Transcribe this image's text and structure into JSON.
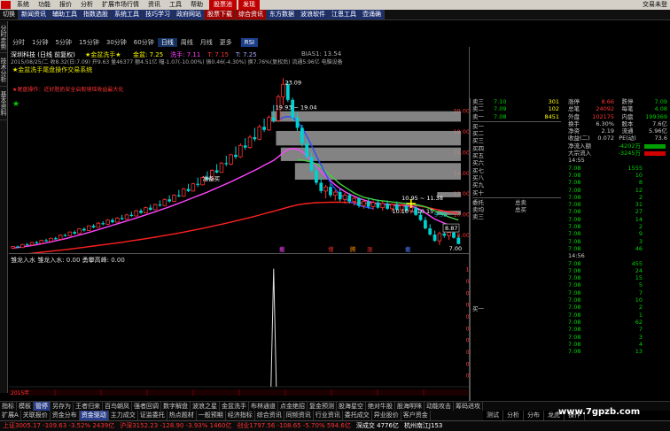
{
  "menu": {
    "items": [
      "系统",
      "功能",
      "报价",
      "分析",
      "扩展市场行情",
      "资讯",
      "工具",
      "帮助"
    ],
    "highlight_items": [
      "股票池",
      "发现"
    ],
    "right_label": "交易未登"
  },
  "toolbar": {
    "items": [
      "切换",
      "新闻资讯",
      "辅助工具",
      "指数选股",
      "系统工具",
      "技巧学习",
      "政府网站",
      "股票下载",
      "综合资讯",
      "东方数据",
      "波浪软件",
      "江恩工具",
      "壶涌确"
    ]
  },
  "left_tabs": [
    "分时走势",
    "技术分析",
    "基本资料"
  ],
  "period_bar": {
    "items": [
      "分时",
      "1分钟",
      "5分钟",
      "15分钟",
      "30分钟",
      "60分钟",
      "日线",
      "周线",
      "月线",
      "更多"
    ],
    "active": "日线",
    "rsi_label": "RSI"
  },
  "main_chart": {
    "header_line1_left": "★金盆洗手★",
    "header_line1_items": [
      "金盆: 7.25",
      "洗手: 7.11",
      "T: 7.15",
      "T: 7.25"
    ],
    "header_line1_bias": "BIAS1: 13.54",
    "header_line2": "2015/08/25/二 收8.32(日:7.09) 开9.63 量46377 额4.51亿 幅-1.07(-10.00%) 振0.46(-4.30%) 换7.76%(复权后) 流通5.96亿 电脑设备",
    "stock_line": "深圳科技 (日线 前复权)",
    "legend1": "★金盆洗手尾盘操作交易系统",
    "legend2": "★尾盘操作：近好胜奶安全启般境瑶收益最大化",
    "peak_label": "23.09",
    "range_label": "19.93 ~ 19.04",
    "buy_label": "准备买",
    "box_label1": "10.95 ~ 11.38",
    "box_label2": "10.10 ~ 10.15",
    "low_label": "7.00",
    "price_tag": "8.87",
    "price_tag2": "9.92",
    "signal_labels": [
      "撤",
      "增",
      "腾",
      "涨",
      "撤"
    ],
    "y_ticks": [
      "20.00",
      "18.00",
      "16.00",
      "14.00",
      "12.00",
      "10.00",
      "8.00"
    ]
  },
  "sub_chart": {
    "header": "雏龙入水 雏龙入水: 0.00 勇攀高峰: 0.00",
    "y_ticks": [
      "1.00",
      "0.90",
      "0.80",
      "0.70",
      "0.60",
      "0.50",
      "0.40",
      "0.30",
      "0.20",
      "0.10"
    ],
    "date_label": "2015年"
  },
  "quote_panel": {
    "sell": [
      {
        "label": "卖三",
        "price": "7.10",
        "vol": "301"
      },
      {
        "label": "卖二",
        "price": "7.09",
        "vol": "102"
      },
      {
        "label": "卖一",
        "price": "7.08",
        "vol": "8451"
      }
    ],
    "buy": [
      "买一",
      "买二",
      "买三",
      "买四",
      "买五",
      "买六",
      "买七",
      "买八",
      "买九",
      "买十"
    ],
    "stats_left": [
      {
        "label": "涨停",
        "value": "8.66"
      },
      {
        "label": "总笔",
        "value": "24092"
      },
      {
        "label": "外盘",
        "value": "102175"
      },
      {
        "label": "换手",
        "value": "6.30%"
      },
      {
        "label": "净资",
        "value": "2.19"
      },
      {
        "label": "收益(二)",
        "value": "0.072"
      }
    ],
    "stats_right": [
      {
        "label": "跌停",
        "value": "7.09"
      },
      {
        "label": "每笔",
        "value": "4.08"
      },
      {
        "label": "内盘",
        "value": "199369"
      },
      {
        "label": "股本",
        "value": "7.6亿"
      },
      {
        "label": "流通",
        "value": "5.96亿"
      },
      {
        "label": "PE(动)",
        "value": "73.6"
      }
    ],
    "flow": [
      {
        "label": "净流入额",
        "value": "-4202万"
      },
      {
        "label": "大宗流入",
        "value": "-3245万"
      }
    ],
    "orders_top": [
      {
        "label": "委托",
        "value": "总卖"
      },
      {
        "label": "卖均",
        "value": "总买"
      }
    ],
    "ticks_time1": "14:55",
    "ticks_time2": "14:56",
    "ticks": [
      {
        "price": "7.08",
        "vol": "1555"
      },
      {
        "price": "7.08",
        "vol": "10"
      },
      {
        "price": "7.08",
        "vol": "8"
      },
      {
        "price": "7.08",
        "vol": "12"
      },
      {
        "price": "7.08",
        "vol": "2"
      },
      {
        "price": "7.08",
        "vol": "31"
      },
      {
        "price": "7.08",
        "vol": "27"
      },
      {
        "price": "7.08",
        "vol": "14"
      },
      {
        "price": "7.08",
        "vol": "2"
      },
      {
        "price": "7.08",
        "vol": "9"
      },
      {
        "price": "7.08",
        "vol": "3"
      },
      {
        "price": "7.08",
        "vol": "46"
      },
      {
        "price": "7.08",
        "vol": "455"
      },
      {
        "price": "7.08",
        "vol": "24"
      },
      {
        "price": "7.08",
        "vol": "15"
      },
      {
        "price": "7.08",
        "vol": "5"
      },
      {
        "price": "7.08",
        "vol": "7"
      },
      {
        "price": "7.08",
        "vol": "10"
      },
      {
        "price": "7.08",
        "vol": "2"
      },
      {
        "price": "7.08",
        "vol": "1"
      },
      {
        "price": "7.08",
        "vol": "62"
      },
      {
        "price": "7.08",
        "vol": "7"
      },
      {
        "price": "7.08",
        "vol": "3"
      },
      {
        "price": "7.08",
        "vol": "4"
      },
      {
        "price": "7.08",
        "vol": "13"
      }
    ]
  },
  "bottom_tabs": [
    "指标",
    "模板",
    "管停",
    "另存为",
    "王者归来",
    "百鸟朝凤",
    "强者回调",
    "数字解盘",
    "波浪之星",
    "金盆洗手",
    "布林通道",
    "点金绝招",
    "复金预测",
    "股海星空",
    "绝对牛股",
    "股海明咪",
    "动能攻击",
    "筹码进攻"
  ],
  "bottom_tabs_active": "管停",
  "bottom_tabs2": [
    "扩展A",
    "关联报价",
    "资金分布",
    "资金驱动",
    "主力成交",
    "证监委托",
    "热点题材",
    "一般预期",
    "经济指标",
    "综合资讯",
    "同频资讯",
    "行业资讯",
    "委托成交",
    "异业股价",
    "客户资金"
  ],
  "bottom_tabs2_active": "资金驱动",
  "right_bottom_tabs": [
    "测试",
    "分析",
    "分布",
    "龙虎",
    "操作"
  ],
  "status": {
    "sh": "上证3005.17 -109.63 -3.52% 2439亿",
    "sz": "沪深3152.23 -128.90 -3.93% 1460亿",
    "cy": "创业1797.56 -108.65 -5.70% 594.6亿",
    "trade": "深成交 4776亿",
    "server": "杭州南江J153"
  },
  "watermark": "www.7gpzb.com",
  "colors": {
    "up": "#ff3232",
    "down": "#00d2d2",
    "ma_pink": "#ff44ff",
    "ma_red": "#ff2020",
    "ma_blue": "#2d4bff",
    "ma_green": "#40d040"
  },
  "chart_data": {
    "type": "candlestick",
    "candles": [
      [
        6.7,
        6.9,
        6.6,
        6.85
      ],
      [
        6.85,
        6.95,
        6.7,
        6.75
      ],
      [
        6.75,
        7.1,
        6.7,
        7.05
      ],
      [
        7.05,
        7.2,
        6.95,
        7.0
      ],
      [
        7.0,
        7.3,
        6.9,
        7.25
      ],
      [
        7.25,
        7.4,
        7.1,
        7.15
      ],
      [
        7.15,
        7.5,
        7.1,
        7.45
      ],
      [
        7.45,
        7.6,
        7.3,
        7.35
      ],
      [
        7.35,
        7.7,
        7.3,
        7.65
      ],
      [
        7.65,
        7.8,
        7.5,
        7.55
      ],
      [
        7.55,
        8.0,
        7.5,
        7.95
      ],
      [
        7.95,
        8.1,
        7.8,
        7.9
      ],
      [
        7.9,
        8.3,
        7.85,
        8.25
      ],
      [
        8.25,
        8.4,
        8.0,
        8.1
      ],
      [
        8.1,
        8.6,
        8.05,
        8.55
      ],
      [
        8.55,
        8.7,
        8.3,
        8.4
      ],
      [
        8.4,
        8.9,
        8.35,
        8.85
      ],
      [
        8.85,
        9.0,
        8.6,
        8.7
      ],
      [
        8.7,
        9.2,
        8.65,
        9.1
      ],
      [
        9.1,
        9.3,
        8.9,
        9.0
      ],
      [
        9.0,
        9.5,
        8.95,
        9.4
      ],
      [
        9.4,
        9.6,
        9.1,
        9.2
      ],
      [
        9.2,
        9.7,
        9.15,
        9.6
      ],
      [
        9.6,
        9.9,
        9.4,
        9.5
      ],
      [
        9.5,
        10.0,
        9.45,
        9.9
      ],
      [
        9.9,
        10.2,
        9.7,
        9.8
      ],
      [
        9.8,
        10.4,
        9.75,
        10.3
      ],
      [
        10.3,
        10.5,
        10.0,
        10.1
      ],
      [
        10.1,
        10.7,
        10.05,
        10.6
      ],
      [
        10.6,
        10.9,
        10.3,
        10.4
      ],
      [
        10.4,
        11.0,
        10.35,
        10.9
      ],
      [
        10.9,
        11.3,
        10.7,
        10.8
      ],
      [
        10.8,
        11.5,
        10.75,
        11.4
      ],
      [
        11.4,
        11.8,
        11.1,
        11.2
      ],
      [
        11.2,
        11.9,
        11.15,
        11.8
      ],
      [
        11.8,
        12.3,
        11.6,
        11.7
      ],
      [
        11.7,
        12.5,
        11.65,
        12.4
      ],
      [
        12.4,
        12.9,
        12.1,
        12.2
      ],
      [
        12.2,
        13.0,
        12.15,
        12.9
      ],
      [
        12.9,
        13.5,
        12.6,
        12.8
      ],
      [
        12.8,
        13.6,
        12.75,
        13.5
      ],
      [
        13.5,
        14.1,
        13.2,
        13.3
      ],
      [
        13.3,
        14.3,
        13.25,
        14.2
      ],
      [
        14.2,
        14.8,
        13.9,
        14.0
      ],
      [
        14.0,
        15.0,
        13.95,
        14.9
      ],
      [
        14.9,
        15.6,
        14.6,
        14.8
      ],
      [
        14.8,
        15.8,
        14.7,
        15.7
      ],
      [
        15.7,
        16.5,
        15.3,
        15.5
      ],
      [
        15.5,
        16.8,
        15.4,
        16.6
      ],
      [
        16.6,
        17.3,
        16.2,
        16.4
      ],
      [
        16.4,
        17.6,
        16.3,
        17.4
      ],
      [
        17.4,
        18.3,
        17.0,
        17.2
      ],
      [
        17.2,
        18.6,
        17.1,
        18.4
      ],
      [
        18.4,
        19.2,
        17.9,
        18.1
      ],
      [
        18.1,
        19.5,
        18.0,
        19.3
      ],
      [
        19.3,
        20.5,
        18.8,
        19.0
      ],
      [
        19.0,
        21.5,
        18.9,
        21.3
      ],
      [
        21.3,
        23.09,
        20.5,
        22.5
      ],
      [
        22.5,
        22.8,
        20.8,
        21.0
      ],
      [
        21.0,
        21.2,
        19.0,
        19.3
      ],
      [
        19.3,
        19.8,
        18.0,
        18.3
      ],
      [
        18.3,
        18.6,
        16.5,
        16.8
      ],
      [
        16.8,
        17.2,
        15.3,
        15.5
      ],
      [
        15.5,
        15.9,
        14.0,
        14.2
      ],
      [
        14.2,
        14.6,
        12.8,
        13.0
      ],
      [
        13.0,
        13.5,
        12.0,
        12.2
      ],
      [
        12.2,
        12.8,
        11.5,
        12.6
      ],
      [
        12.6,
        12.9,
        11.6,
        11.8
      ],
      [
        11.8,
        12.3,
        11.3,
        12.1
      ],
      [
        12.1,
        12.4,
        11.2,
        11.4
      ],
      [
        11.4,
        12.0,
        11.0,
        11.8
      ],
      [
        11.8,
        12.0,
        11.0,
        11.2
      ],
      [
        11.2,
        11.7,
        10.8,
        11.5
      ],
      [
        11.5,
        11.6,
        10.6,
        10.8
      ],
      [
        10.8,
        11.4,
        10.5,
        11.2
      ],
      [
        11.2,
        11.5,
        10.5,
        10.7
      ],
      [
        10.7,
        11.3,
        10.4,
        11.1
      ],
      [
        11.1,
        11.4,
        10.5,
        10.6
      ],
      [
        10.6,
        11.2,
        10.3,
        11.0
      ],
      [
        11.0,
        11.3,
        10.4,
        10.5
      ],
      [
        10.5,
        11.0,
        10.2,
        10.9
      ],
      [
        10.9,
        11.2,
        10.3,
        10.4
      ],
      [
        10.4,
        10.9,
        10.1,
        10.8
      ],
      [
        10.8,
        11.1,
        10.2,
        10.3
      ],
      [
        10.3,
        10.8,
        10.0,
        10.6
      ],
      [
        10.6,
        10.9,
        9.8,
        9.9
      ],
      [
        9.9,
        10.3,
        9.3,
        9.4
      ],
      [
        9.4,
        9.7,
        8.5,
        8.6
      ],
      [
        8.6,
        9.0,
        7.9,
        8.0
      ],
      [
        8.0,
        8.4,
        7.3,
        7.4
      ],
      [
        7.4,
        8.3,
        7.0,
        8.1
      ],
      [
        8.1,
        8.6,
        7.7,
        7.9
      ],
      [
        7.9,
        8.4,
        7.5,
        8.2
      ],
      [
        8.2,
        8.5,
        7.6,
        7.7
      ],
      [
        7.7,
        7.9,
        7.09,
        7.09
      ]
    ],
    "ma_pink": [
      6.7,
      6.75,
      6.82,
      6.88,
      6.95,
      7.02,
      7.1,
      7.2,
      7.3,
      7.4,
      7.5,
      7.6,
      7.72,
      7.84,
      7.96,
      8.08,
      8.2,
      8.34,
      8.48,
      8.62,
      8.76,
      8.9,
      9.04,
      9.18,
      9.32,
      9.46,
      9.6,
      9.75,
      9.9,
      10.05,
      10.2,
      10.36,
      10.52,
      10.68,
      10.85,
      11.02,
      11.2,
      11.38,
      11.56,
      11.74,
      11.92,
      12.1,
      12.3,
      12.5,
      12.7,
      12.9,
      13.1,
      13.32,
      13.54,
      13.76,
      13.98,
      14.2,
      14.44,
      14.68,
      14.92,
      15.16,
      15.5,
      15.9,
      16.2,
      16.3,
      16.25,
      16.0,
      15.6,
      15.1,
      14.6,
      14.1,
      13.6,
      13.2,
      12.8,
      12.45,
      12.15,
      11.9,
      11.7,
      11.5,
      11.35,
      11.2,
      11.1,
      11.0,
      10.95,
      10.9,
      10.85,
      10.8,
      10.78,
      10.76,
      10.74,
      10.6,
      10.4,
      10.1,
      9.8,
      9.5,
      9.3,
      9.1,
      8.9,
      8.75,
      8.6
    ],
    "ma_red": [
      6.0,
      6.05,
      6.1,
      6.15,
      6.2,
      6.25,
      6.3,
      6.35,
      6.4,
      6.45,
      6.5,
      6.55,
      6.6,
      6.66,
      6.72,
      6.78,
      6.84,
      6.9,
      6.96,
      7.02,
      7.08,
      7.14,
      7.2,
      7.26,
      7.33,
      7.4,
      7.47,
      7.54,
      7.61,
      7.68,
      7.75,
      7.83,
      7.91,
      7.99,
      8.07,
      8.15,
      8.24,
      8.33,
      8.42,
      8.51,
      8.6,
      8.7,
      8.8,
      8.9,
      9.0,
      9.1,
      9.21,
      9.32,
      9.43,
      9.54,
      9.65,
      9.77,
      9.89,
      10.01,
      10.13,
      10.25,
      10.38,
      10.51,
      10.64,
      10.76,
      10.86,
      10.94,
      11.0,
      11.05,
      11.08,
      11.1,
      11.11,
      11.12,
      11.12,
      11.12,
      11.11,
      11.1,
      11.08,
      11.06,
      11.04,
      11.02,
      11.0,
      10.98,
      10.96,
      10.94,
      10.92,
      10.9,
      10.88,
      10.86,
      10.84,
      10.8,
      10.74,
      10.66,
      10.56,
      10.46,
      10.37,
      10.28,
      10.2,
      10.12,
      10.04
    ],
    "ma_blue_start": 56,
    "ma_blue": [
      19.0,
      19.3,
      19.4,
      19.3,
      18.9,
      18.3,
      17.5,
      16.6,
      15.6,
      14.7,
      13.8,
      13.0,
      12.4,
      11.9,
      11.5,
      11.2,
      11.0,
      10.8,
      10.7,
      10.6,
      10.5
    ],
    "ma_green_start": 60,
    "ma_green": [
      15.2,
      15.2,
      15.1,
      15.0,
      14.8,
      14.5,
      14.1,
      13.7,
      13.3,
      12.9,
      12.6,
      12.3,
      12.0,
      11.8,
      11.6,
      11.5,
      11.4,
      11.3,
      11.25,
      11.2,
      11.15,
      11.1,
      11.05,
      11.0,
      10.95,
      10.9,
      10.8,
      10.7,
      10.5,
      10.3,
      10.1,
      9.9,
      9.7,
      9.55,
      9.4
    ],
    "gray_boxes": [
      [
        55,
        94,
        19.9,
        18.9
      ],
      [
        56,
        94,
        18.0,
        16.6
      ],
      [
        57,
        94,
        16.4,
        15.1
      ],
      [
        60,
        94,
        14.9,
        13.3
      ],
      [
        90,
        94,
        12.1,
        11.6
      ],
      [
        90,
        94,
        10.3,
        9.9
      ]
    ],
    "ylim": [
      6.3,
      24.4
    ],
    "sub_series": {
      "type": "bar",
      "spike_index": 55,
      "spike_value": 1.0,
      "ylim": [
        0,
        1.05
      ]
    }
  }
}
